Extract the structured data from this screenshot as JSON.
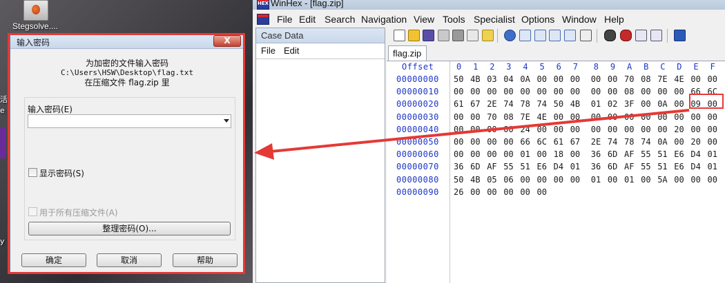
{
  "desktop": {
    "icon_label": "Stegsolve....",
    "edge_text_1": "活",
    "edge_text_2": "e",
    "edge_text_3": "y"
  },
  "dialog": {
    "title": "输入密码",
    "close_label": "X",
    "info_line1": "为加密的文件输入密码",
    "info_line2": "C:\\Users\\HSW\\Desktop\\flag.txt",
    "info_line3": "在压缩文件 flag.zip 里",
    "password_label": "输入密码(E)",
    "password_value": "",
    "show_password_label": "显示密码(S)",
    "use_for_all_label": "用于所有压缩文件(A)",
    "organize_button": "整理密码(O)...",
    "ok_button": "确定",
    "cancel_button": "取消",
    "help_button": "帮助"
  },
  "winhex": {
    "title": "WinHex - [flag.zip]",
    "menu": [
      "File",
      "Edit",
      "Search",
      "Navigation",
      "View",
      "Tools",
      "Specialist",
      "Options",
      "Window",
      "Help"
    ],
    "case_panel": {
      "title": "Case Data",
      "menu": [
        "File",
        "Edit"
      ]
    },
    "tab_label": "flag.zip",
    "hex": {
      "offset_header": "Offset",
      "columns": [
        "0",
        "1",
        "2",
        "3",
        "4",
        "5",
        "6",
        "7",
        "8",
        "9",
        "A",
        "B",
        "C",
        "D",
        "E",
        "F"
      ],
      "rows": [
        {
          "offset": "00000000",
          "bytes": [
            "50",
            "4B",
            "03",
            "04",
            "0A",
            "00",
            "00",
            "00",
            "00",
            "00",
            "70",
            "08",
            "7E",
            "4E",
            "00",
            "00"
          ]
        },
        {
          "offset": "00000010",
          "bytes": [
            "00",
            "00",
            "00",
            "00",
            "00",
            "00",
            "00",
            "00",
            "00",
            "00",
            "08",
            "00",
            "00",
            "00",
            "66",
            "6C"
          ]
        },
        {
          "offset": "00000020",
          "bytes": [
            "61",
            "67",
            "2E",
            "74",
            "78",
            "74",
            "50",
            "4B",
            "01",
            "02",
            "3F",
            "00",
            "0A",
            "00",
            "09",
            "00"
          ]
        },
        {
          "offset": "00000030",
          "bytes": [
            "00",
            "00",
            "70",
            "08",
            "7E",
            "4E",
            "00",
            "00",
            "00",
            "00",
            "00",
            "00",
            "00",
            "00",
            "00",
            "00"
          ]
        },
        {
          "offset": "00000040",
          "bytes": [
            "00",
            "00",
            "00",
            "00",
            "24",
            "00",
            "00",
            "00",
            "00",
            "00",
            "00",
            "00",
            "00",
            "20",
            "00",
            "00"
          ]
        },
        {
          "offset": "00000050",
          "bytes": [
            "00",
            "00",
            "00",
            "00",
            "66",
            "6C",
            "61",
            "67",
            "2E",
            "74",
            "78",
            "74",
            "0A",
            "00",
            "20",
            "00"
          ]
        },
        {
          "offset": "00000060",
          "bytes": [
            "00",
            "00",
            "00",
            "00",
            "01",
            "00",
            "18",
            "00",
            "36",
            "6D",
            "AF",
            "55",
            "51",
            "E6",
            "D4",
            "01"
          ]
        },
        {
          "offset": "00000070",
          "bytes": [
            "36",
            "6D",
            "AF",
            "55",
            "51",
            "E6",
            "D4",
            "01",
            "36",
            "6D",
            "AF",
            "55",
            "51",
            "E6",
            "D4",
            "01"
          ]
        },
        {
          "offset": "00000080",
          "bytes": [
            "50",
            "4B",
            "05",
            "06",
            "00",
            "00",
            "00",
            "00",
            "01",
            "00",
            "01",
            "00",
            "5A",
            "00",
            "00",
            "00"
          ]
        },
        {
          "offset": "00000090",
          "bytes": [
            "26",
            "00",
            "00",
            "00",
            "00",
            "00",
            "",
            "",
            "",
            "",
            "",
            "",
            "",
            "",
            "",
            ""
          ]
        }
      ]
    }
  },
  "annotations": {
    "highlight_color": "#e53935",
    "arrow_color": "#e53935"
  }
}
